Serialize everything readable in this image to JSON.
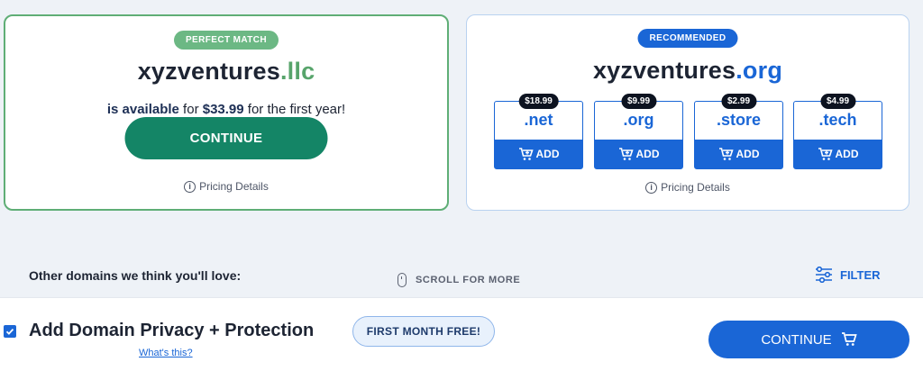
{
  "perfect_match": {
    "badge": "PERFECT MATCH",
    "domain_name": "xyzventures",
    "domain_ext": ".llc",
    "available_text": "is available",
    "for_text": " for ",
    "price": "$33.99",
    "period_text": " for the first year!",
    "continue_label": "CONTINUE",
    "pricing_details": "Pricing Details"
  },
  "recommended": {
    "badge": "RECOMMENDED",
    "domain_name": "xyzventures",
    "domain_ext": ".org",
    "pricing_details": "Pricing Details",
    "tlds": [
      {
        "ext": ".net",
        "price": "$18.99",
        "add_label": "ADD"
      },
      {
        "ext": ".org",
        "price": "$9.99",
        "add_label": "ADD"
      },
      {
        "ext": ".store",
        "price": "$2.99",
        "add_label": "ADD"
      },
      {
        "ext": ".tech",
        "price": "$4.99",
        "add_label": "ADD"
      }
    ]
  },
  "other_domains": {
    "label": "Other domains we think you'll love:",
    "scroll_hint": "SCROLL FOR MORE",
    "filter_label": "FILTER"
  },
  "bottom_bar": {
    "privacy_label": "Add Domain Privacy + Protection",
    "privacy_checked": true,
    "whats_this": "What's this?",
    "free_badge": "FIRST MONTH FREE!",
    "continue_label": "CONTINUE"
  },
  "colors": {
    "green_accent": "#148566",
    "blue_accent": "#1a66d6",
    "badge_green": "#6cb884"
  }
}
